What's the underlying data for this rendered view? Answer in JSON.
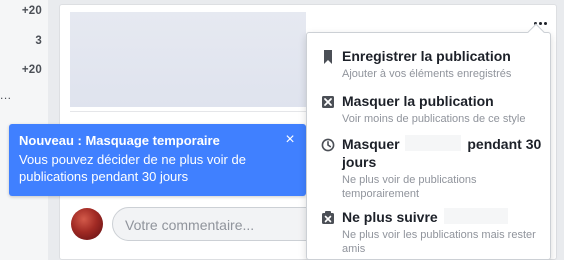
{
  "counts": [
    "+20",
    "3",
    "+20"
  ],
  "left_ellipsis": "...",
  "comment": {
    "placeholder": "Votre commentaire..."
  },
  "tooltip": {
    "title": "Nouveau : Masquage temporaire",
    "body": "Vous pouvez décider de ne plus voir de publications pendant 30 jours",
    "close": "×"
  },
  "menu": {
    "items": [
      {
        "icon": "bookmark-icon",
        "title": "Enregistrer la publication",
        "desc": "Ajouter à vos éléments enregistrés"
      },
      {
        "icon": "hide-box-icon",
        "title": "Masquer la publication",
        "desc": "Voir moins de publications de ce style"
      },
      {
        "icon": "clock-icon",
        "title_before": "Masquer",
        "title_after": "pendant 30 jours",
        "desc": "Ne plus voir de publications temporairement"
      },
      {
        "icon": "unfollow-icon",
        "title": "Ne plus suivre",
        "desc": "Ne plus voir les publications mais rester amis"
      }
    ]
  },
  "colors": {
    "tooltip_bg": "#4080ff",
    "background": "#e9ebee",
    "muted_text": "#90949c"
  }
}
